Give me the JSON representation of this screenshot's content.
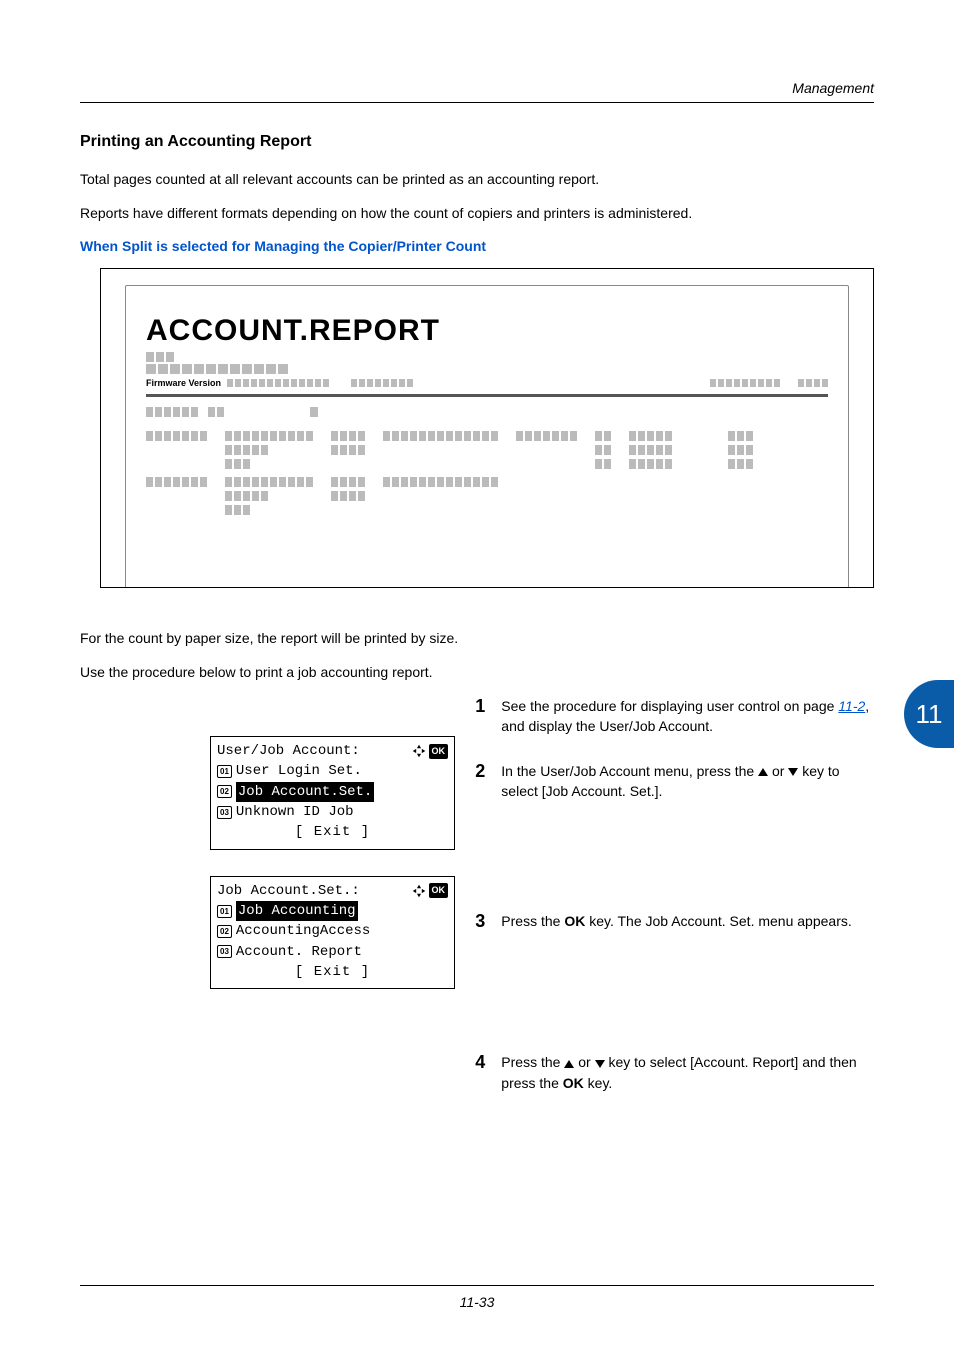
{
  "header": {
    "section": "Management"
  },
  "heading": "Printing an Accounting Report",
  "paragraphs": {
    "p1": "Total pages counted at all relevant accounts can be printed as an accounting report.",
    "p2": "Reports have different formats depending on how the count of copiers and printers is administered.",
    "sub_blue": "When Split is selected for Managing the Copier/Printer Count",
    "p3": "For the count by paper size, the report will be printed by size.",
    "p4": "Use the procedure below to print a job accounting report."
  },
  "report_preview": {
    "title": "ACCOUNT.REPORT",
    "firmware_label": "Firmware Version"
  },
  "lcd1": {
    "title": "User/Job Account:",
    "items": [
      {
        "num": "01",
        "label": "User Login Set.",
        "selected": false
      },
      {
        "num": "02",
        "label": "Job Account.Set.",
        "selected": true
      },
      {
        "num": "03",
        "label": "Unknown ID Job",
        "selected": false
      }
    ],
    "exit": "[  Exit   ]"
  },
  "lcd2": {
    "title": "Job Account.Set.:",
    "items": [
      {
        "num": "01",
        "label": "Job Accounting",
        "selected": true
      },
      {
        "num": "02",
        "label": "AccountingAccess",
        "selected": false
      },
      {
        "num": "03",
        "label": "Account. Report",
        "selected": false
      }
    ],
    "exit": "[  Exit   ]"
  },
  "steps": {
    "s1": {
      "num": "1",
      "text_a": "See the procedure for displaying user control on page ",
      "link": "11-2",
      "text_b": ", and display the User/Job Account."
    },
    "s2": {
      "num": "2",
      "text_a": "In the User/Job Account menu, press the ",
      "text_b": " or ",
      "text_c": " key to select [Job Account. Set.]."
    },
    "s3": {
      "num": "3",
      "text_a": "Press the ",
      "ok": "OK",
      "text_b": " key. The Job Account. Set. menu appears."
    },
    "s4": {
      "num": "4",
      "text_a": "Press the ",
      "text_b": " or ",
      "text_c": " key to select [Account. Report] and then press the ",
      "ok": "OK",
      "text_d": " key."
    }
  },
  "side_tab": "11",
  "footer": "11-33",
  "icons": {
    "ok": "OK"
  }
}
